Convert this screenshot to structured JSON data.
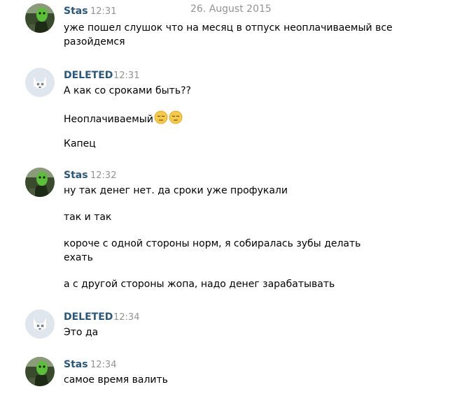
{
  "date_header": "26. August 2015",
  "messages": [
    {
      "author": "Stas",
      "time": "12:31",
      "lines": [
        "уже пошел слушок что на месяц в отпуск неоплачиваемый все",
        "разойдемся"
      ]
    },
    {
      "author": "DELETED",
      "time": "12:31",
      "lines": [
        "А как со сроками быть??",
        "Неоплачиваемый",
        "Капец"
      ],
      "emoji": [
        "pensive-face-icon",
        "pensive-face-icon"
      ]
    },
    {
      "author": "Stas",
      "time": "12:32",
      "lines": [
        "ну так денег нет. да сроки уже профукали",
        "так и так",
        "короче с одной стороны норм, я собиралась зубы делать",
        "ехать",
        "а с другой стороны жопа, надо денег зарабатывать"
      ]
    },
    {
      "author": "DELETED",
      "time": "12:34",
      "lines": [
        "Это да"
      ]
    },
    {
      "author": "Stas",
      "time": "12:34",
      "lines": [
        "самое время валить"
      ]
    }
  ],
  "colors": {
    "author_name": "#2b587a",
    "timestamp": "#939393",
    "deleted_avatar_bg": "#dfe6ed",
    "emoji_face": "#f6c94a"
  }
}
